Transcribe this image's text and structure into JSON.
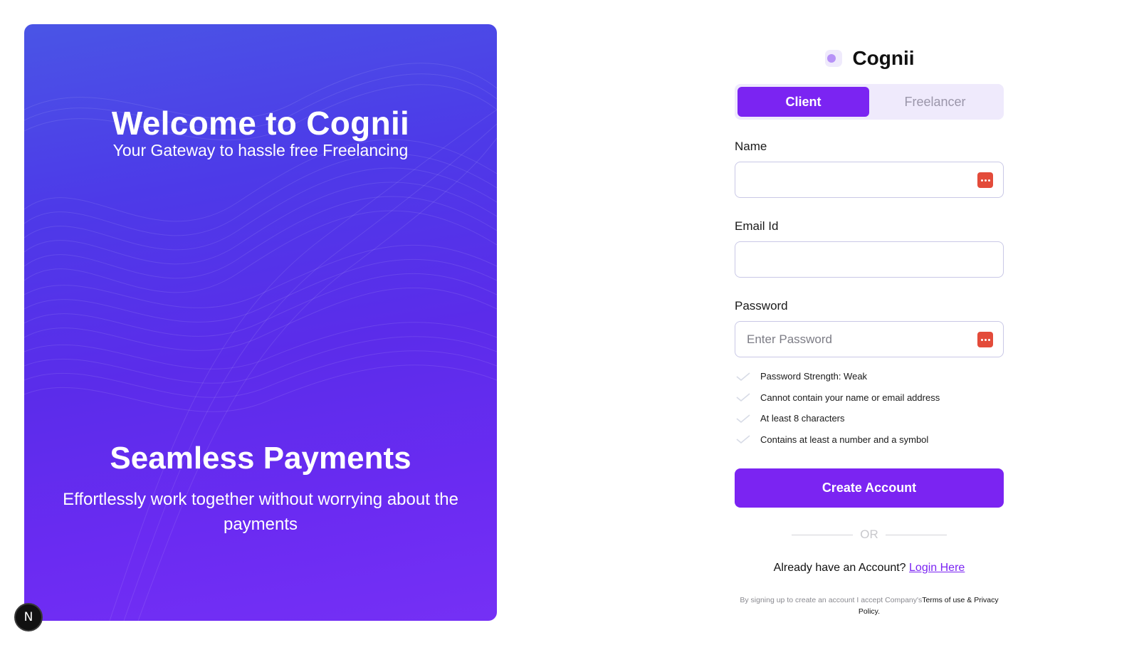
{
  "hero": {
    "title": "Welcome to Cognii",
    "subtitle": "Your Gateway to hassle free Freelancing",
    "feature_title": "Seamless Payments",
    "feature_text": "Effortlessly work together without worrying about the payments"
  },
  "badge": {
    "letter": "N"
  },
  "brand": {
    "name": "Cognii",
    "logo_icon": "cognii-logo-icon"
  },
  "toggle": {
    "client": "Client",
    "freelancer": "Freelancer",
    "active": "Client"
  },
  "form": {
    "name_label": "Name",
    "name_value": "",
    "email_label": "Email Id",
    "email_value": "",
    "password_label": "Password",
    "password_placeholder": "Enter Password",
    "rules": [
      "Password Strength: Weak",
      "Cannot contain your name or email address",
      "At least 8 characters",
      "Contains at least a number and a symbol"
    ],
    "submit": "Create Account",
    "or": "OR",
    "login_prompt": "Already have an Account? ",
    "login_link": "Login Here",
    "terms_prefix": "By signing up to create an account I accept Company's",
    "terms_link": "Terms of use & Privacy Policy."
  },
  "colors": {
    "accent": "#7b24f2",
    "toggle_bg": "#efeafc",
    "password_manager_icon": "#e34b3a"
  }
}
